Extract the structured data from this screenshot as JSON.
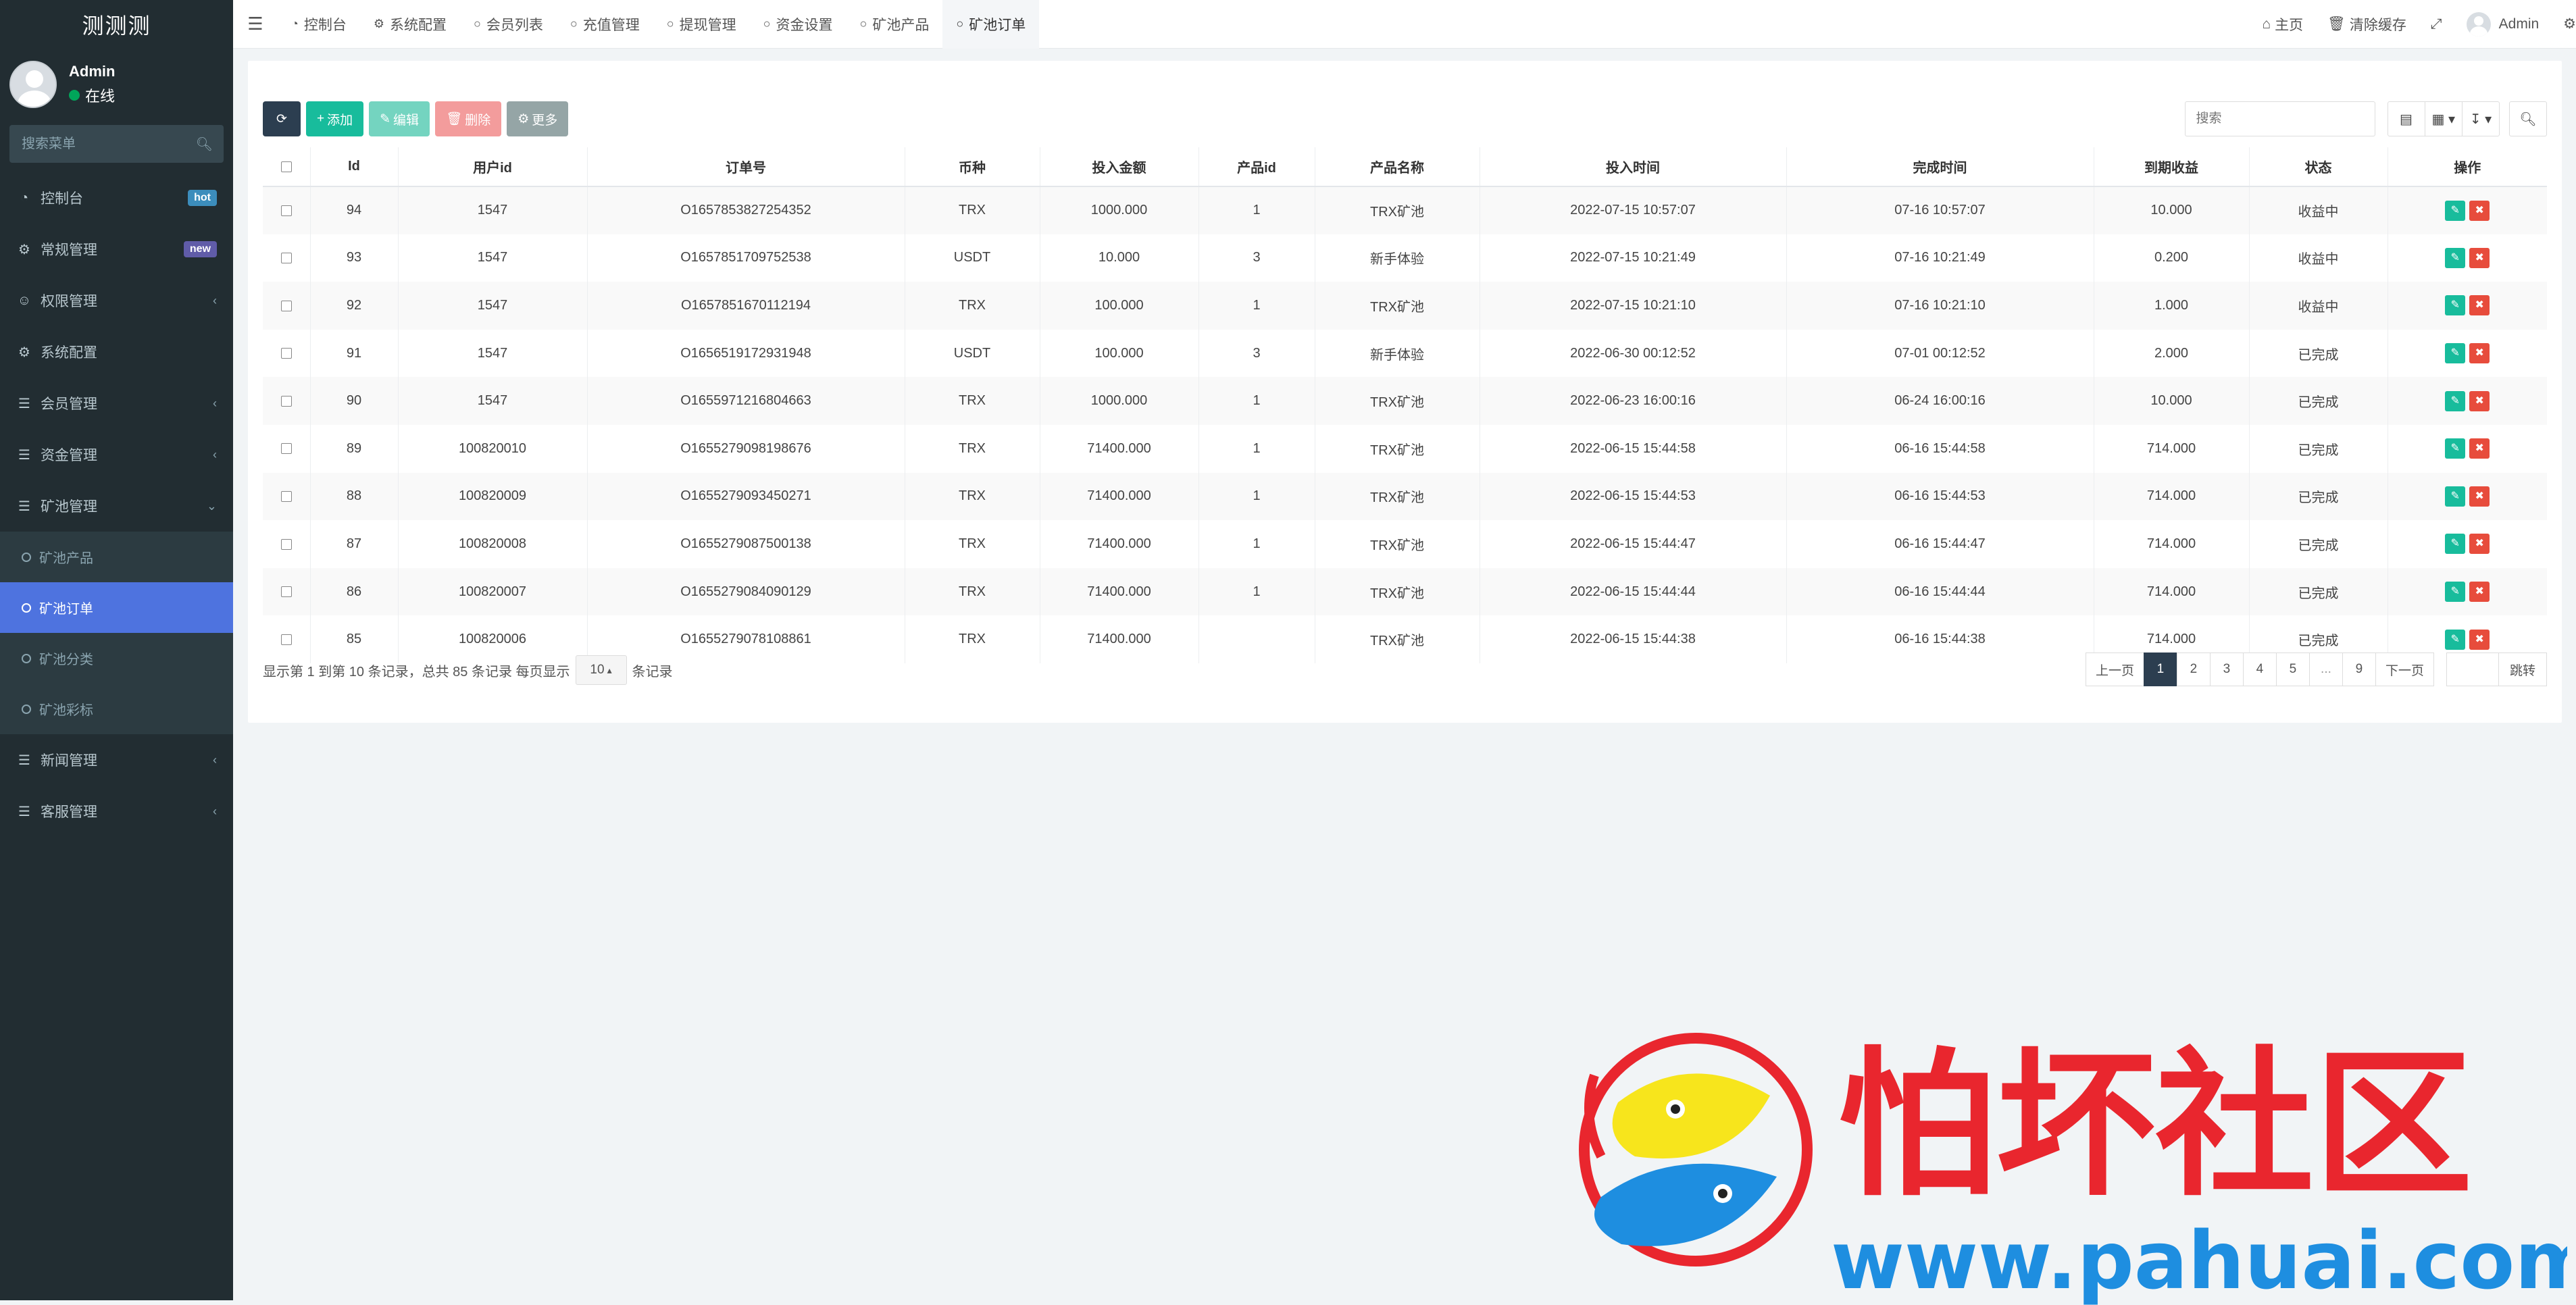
{
  "app": {
    "title": "测测测"
  },
  "user": {
    "name": "Admin",
    "status": "在线"
  },
  "sidebar": {
    "search_placeholder": "搜索菜单",
    "items": [
      {
        "label": "控制台",
        "icon": "dashboard-icon",
        "badge": "hot",
        "badge_color": "#3c8dbc"
      },
      {
        "label": "常规管理",
        "icon": "cogs-icon",
        "badge": "new",
        "badge_color": "#605ca8"
      },
      {
        "label": "权限管理",
        "icon": "group-icon"
      },
      {
        "label": "系统配置",
        "icon": "gear-icon"
      },
      {
        "label": "会员管理",
        "icon": "list-icon"
      },
      {
        "label": "资金管理",
        "icon": "list-icon"
      },
      {
        "label": "矿池管理",
        "icon": "list-icon",
        "expanded": true
      }
    ],
    "subitems": [
      {
        "label": "矿池产品"
      },
      {
        "label": "矿池订单",
        "active": true
      },
      {
        "label": "矿池分类"
      },
      {
        "label": "矿池彩标"
      }
    ],
    "items_after": [
      {
        "label": "新闻管理",
        "icon": "list-icon"
      },
      {
        "label": "客服管理",
        "icon": "list-icon"
      }
    ]
  },
  "topnav": {
    "tabs": [
      {
        "label": "控制台",
        "icon": "dashboard-icon"
      },
      {
        "label": "系统配置",
        "icon": "gear-icon"
      },
      {
        "label": "会员列表",
        "icon": "circle-icon"
      },
      {
        "label": "充值管理",
        "icon": "circle-icon"
      },
      {
        "label": "提现管理",
        "icon": "circle-icon"
      },
      {
        "label": "资金设置",
        "icon": "circle-icon"
      },
      {
        "label": "矿池产品",
        "icon": "circle-icon"
      },
      {
        "label": "矿池订单",
        "icon": "circle-icon",
        "active": true
      }
    ],
    "home": "主页",
    "clear_cache": "清除缓存",
    "admin": "Admin"
  },
  "toolbar": {
    "add": "添加",
    "edit": "编辑",
    "delete": "删除",
    "more": "更多",
    "search_placeholder": "搜索"
  },
  "table": {
    "columns": [
      "Id",
      "用户id",
      "订单号",
      "币种",
      "投入金额",
      "产品id",
      "产品名称",
      "投入时间",
      "完成时间",
      "到期收益",
      "状态",
      "操作"
    ],
    "rows": [
      [
        "94",
        "1547",
        "O1657853827254352",
        "TRX",
        "1000.000",
        "1",
        "TRX矿池",
        "2022-07-15 10:57:07",
        "07-16 10:57:07",
        "10.000",
        "收益中"
      ],
      [
        "93",
        "1547",
        "O1657851709752538",
        "USDT",
        "10.000",
        "3",
        "新手体验",
        "2022-07-15 10:21:49",
        "07-16 10:21:49",
        "0.200",
        "收益中"
      ],
      [
        "92",
        "1547",
        "O1657851670112194",
        "TRX",
        "100.000",
        "1",
        "TRX矿池",
        "2022-07-15 10:21:10",
        "07-16 10:21:10",
        "1.000",
        "收益中"
      ],
      [
        "91",
        "1547",
        "O1656519172931948",
        "USDT",
        "100.000",
        "3",
        "新手体验",
        "2022-06-30 00:12:52",
        "07-01 00:12:52",
        "2.000",
        "已完成"
      ],
      [
        "90",
        "1547",
        "O1655971216804663",
        "TRX",
        "1000.000",
        "1",
        "TRX矿池",
        "2022-06-23 16:00:16",
        "06-24 16:00:16",
        "10.000",
        "已完成"
      ],
      [
        "89",
        "100820010",
        "O1655279098198676",
        "TRX",
        "71400.000",
        "1",
        "TRX矿池",
        "2022-06-15 15:44:58",
        "06-16 15:44:58",
        "714.000",
        "已完成"
      ],
      [
        "88",
        "100820009",
        "O1655279093450271",
        "TRX",
        "71400.000",
        "1",
        "TRX矿池",
        "2022-06-15 15:44:53",
        "06-16 15:44:53",
        "714.000",
        "已完成"
      ],
      [
        "87",
        "100820008",
        "O1655279087500138",
        "TRX",
        "71400.000",
        "1",
        "TRX矿池",
        "2022-06-15 15:44:47",
        "06-16 15:44:47",
        "714.000",
        "已完成"
      ],
      [
        "86",
        "100820007",
        "O1655279084090129",
        "TRX",
        "71400.000",
        "1",
        "TRX矿池",
        "2022-06-15 15:44:44",
        "06-16 15:44:44",
        "714.000",
        "已完成"
      ],
      [
        "85",
        "100820006",
        "O1655279078108861",
        "TRX",
        "71400.000",
        "",
        "TRX矿池",
        "2022-06-15 15:44:38",
        "06-16 15:44:38",
        "714.000",
        "已完成"
      ]
    ]
  },
  "footer": {
    "info_prefix": "显示第 1 到第 10 条记录，总共 85 条记录 每页显示",
    "page_size": "10",
    "info_suffix": "条记录",
    "pages": [
      "上一页",
      "1",
      "2",
      "3",
      "4",
      "5",
      "...",
      "9",
      "下一页"
    ],
    "jump": "跳转"
  },
  "watermark": {
    "cn": "怕坏社区",
    "url": "www.pahuai.com"
  }
}
